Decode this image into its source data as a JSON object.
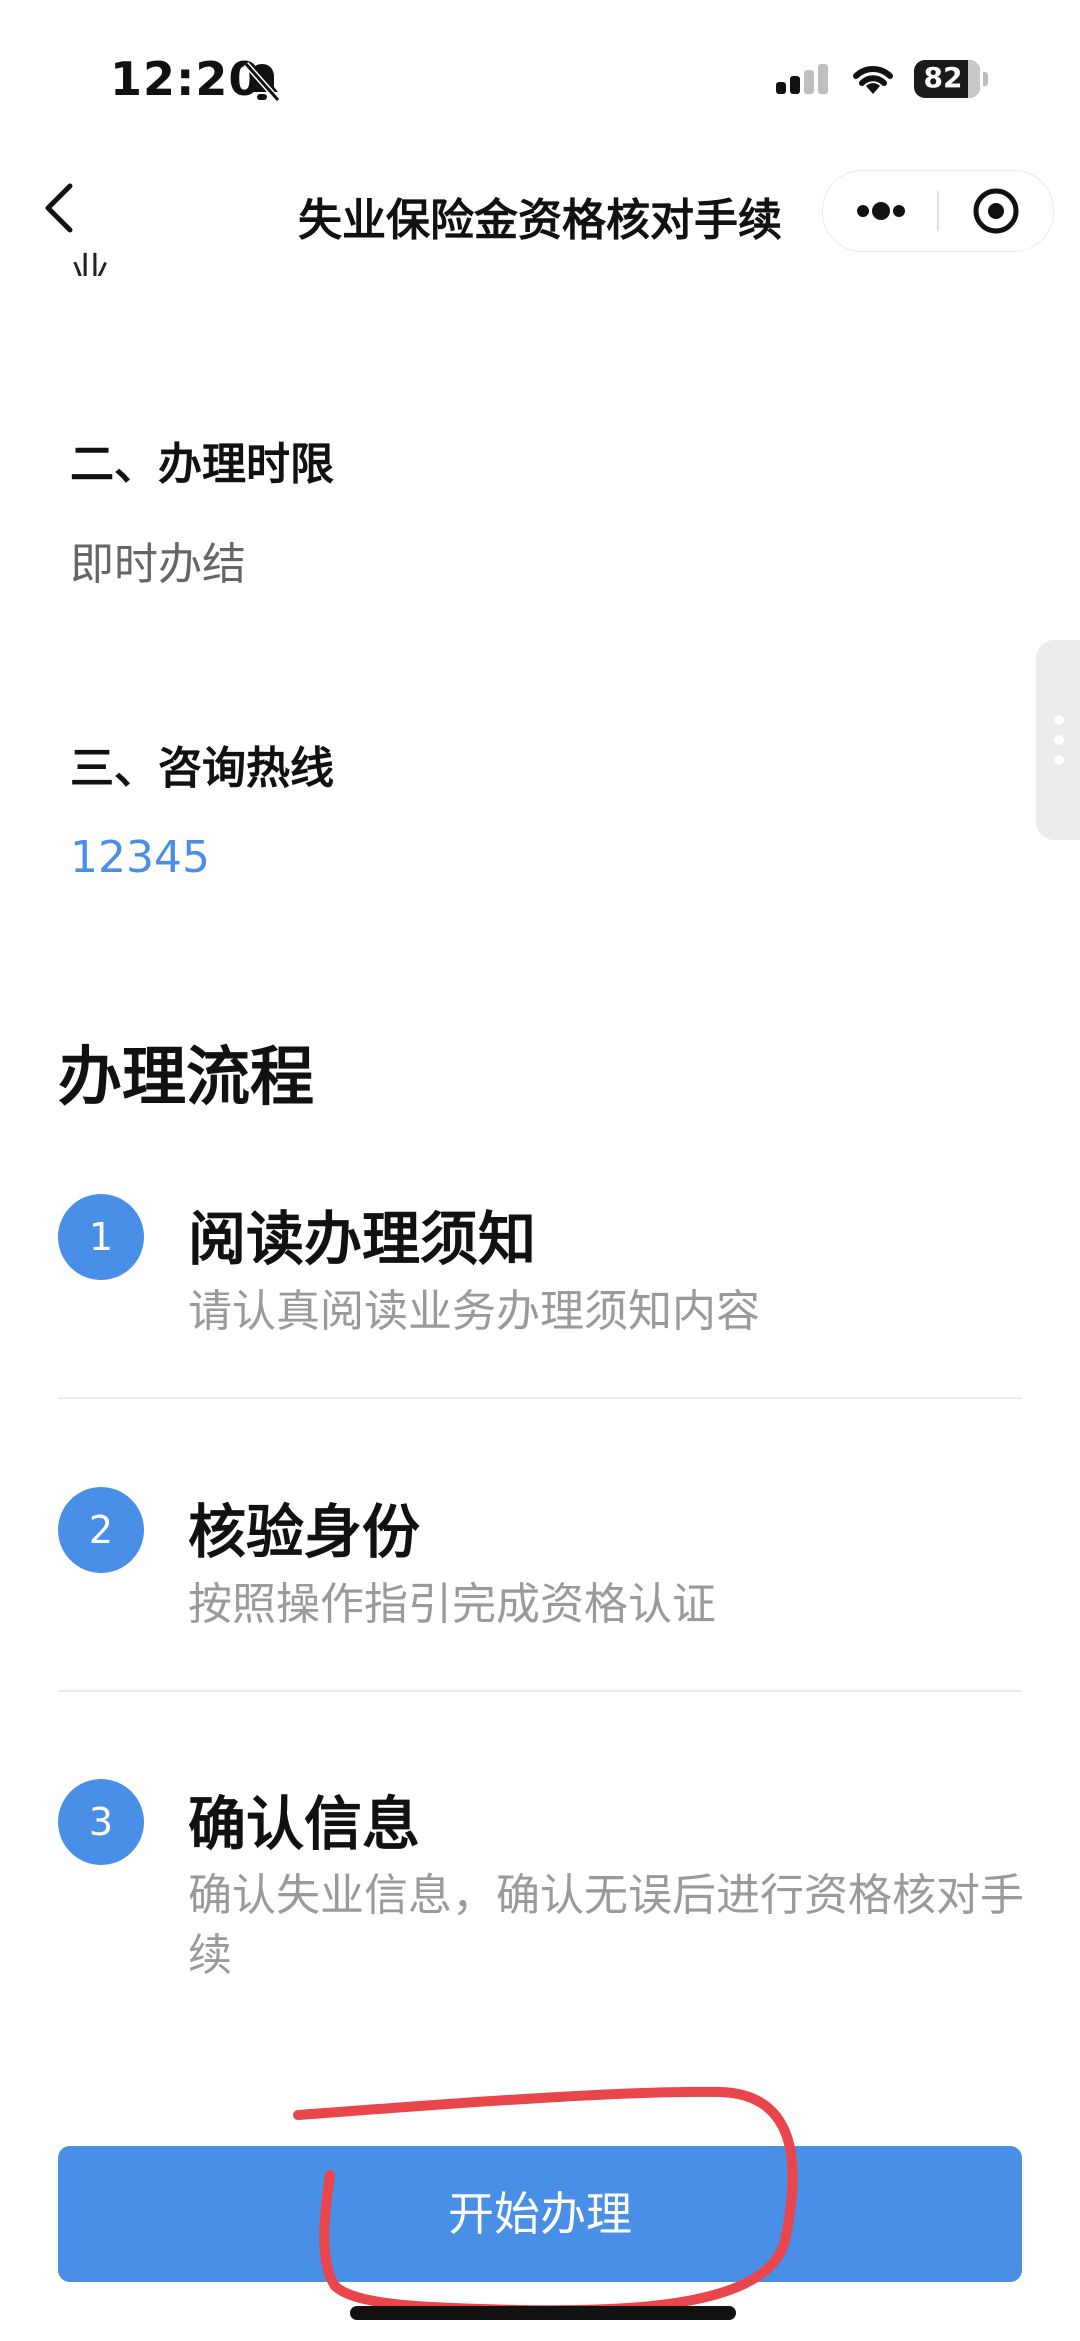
{
  "status_bar": {
    "time": "12:20",
    "battery": "82"
  },
  "nav": {
    "title": "失业保险金资格核对手续"
  },
  "cut_text": "业。",
  "sections": [
    {
      "heading": "二、办理时限",
      "value": "即时办结"
    },
    {
      "heading": "三、咨询热线",
      "value": "12345"
    }
  ],
  "flow": {
    "title": "办理流程",
    "steps": [
      {
        "num": "1",
        "title": "阅读办理须知",
        "desc": "请认真阅读业务办理须知内容"
      },
      {
        "num": "2",
        "title": "核验身份",
        "desc": "按照操作指引完成资格认证"
      },
      {
        "num": "3",
        "title": "确认信息",
        "desc": "确认失业信息，确认无误后进行资格核对手续"
      }
    ]
  },
  "start_button": "开始办理",
  "colors": {
    "accent": "#4a8fe7",
    "annotation": "#e8464b"
  }
}
